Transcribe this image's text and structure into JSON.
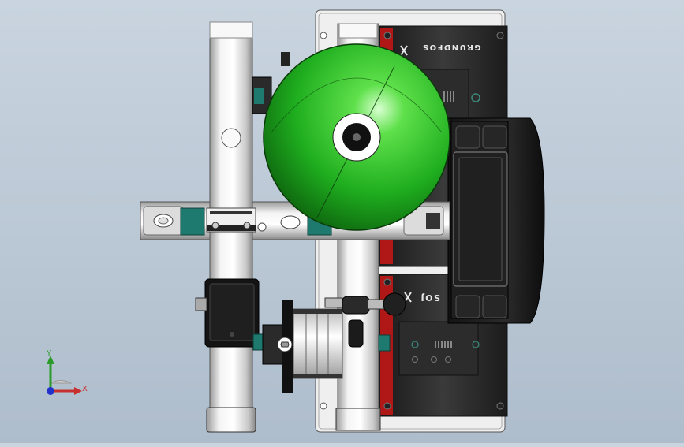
{
  "viewport": {
    "brand_top": "GRUNDFOS",
    "brand_bottom": "SOJ",
    "colors": {
      "background_top": "#c9d4df",
      "background_bottom": "#aebdcc",
      "tank_green": "#1fae1f",
      "pump_body": "#222222",
      "pump_accent_red": "#b01818",
      "pipe_silver": "#e6e6e6",
      "fitting_teal": "#1e7a6e"
    }
  },
  "triad": {
    "x_label": "X",
    "y_label": "Y"
  }
}
